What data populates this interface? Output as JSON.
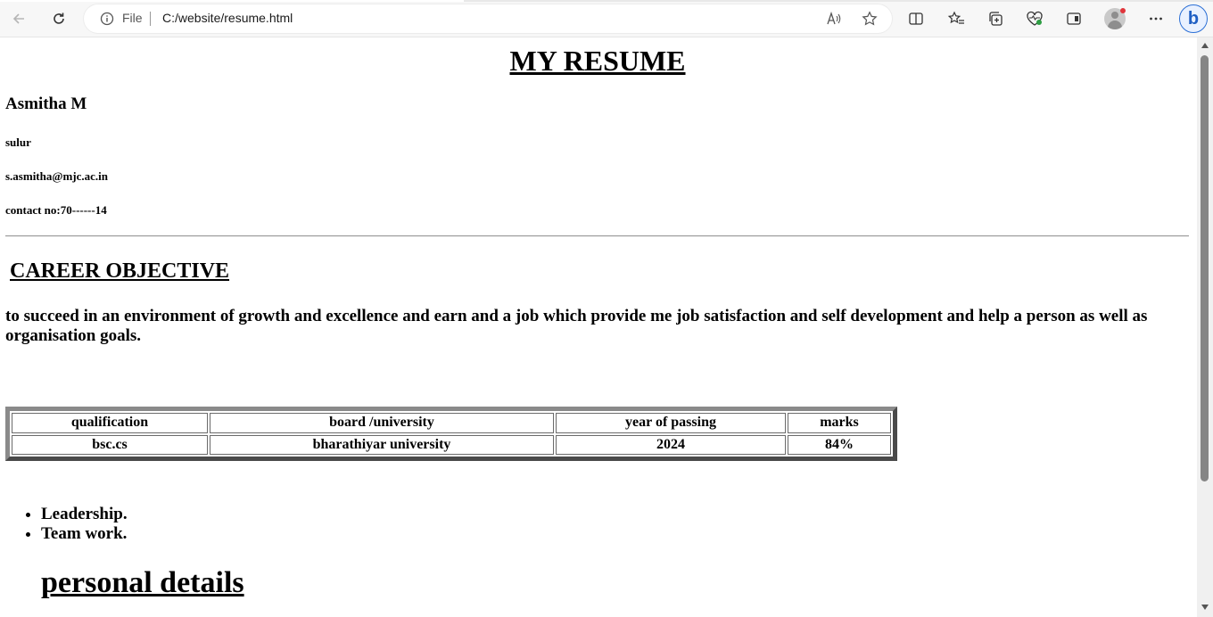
{
  "browser": {
    "scheme_label": "File",
    "url": "C:/website/resume.html"
  },
  "resume": {
    "title": "MY RESUME",
    "name": "Asmitha M",
    "location": "sulur",
    "email": "s.asmitha@mjc.ac.in",
    "contact": "contact no:70------14",
    "career_heading": "CAREER OBJECTIVE",
    "career_text": "to succeed in an environment of growth and excellence and earn and a job which provide me job satisfaction and self development and help a person as well as organisation goals.",
    "table": {
      "headers": [
        "qualification",
        "board /university",
        "year of passing",
        "marks"
      ],
      "rows": [
        [
          "bsc.cs",
          "bharathiyar university",
          "2024",
          "84%"
        ]
      ]
    },
    "skills": [
      "Leadership.",
      "Team work."
    ],
    "personal_heading": "personal details"
  }
}
